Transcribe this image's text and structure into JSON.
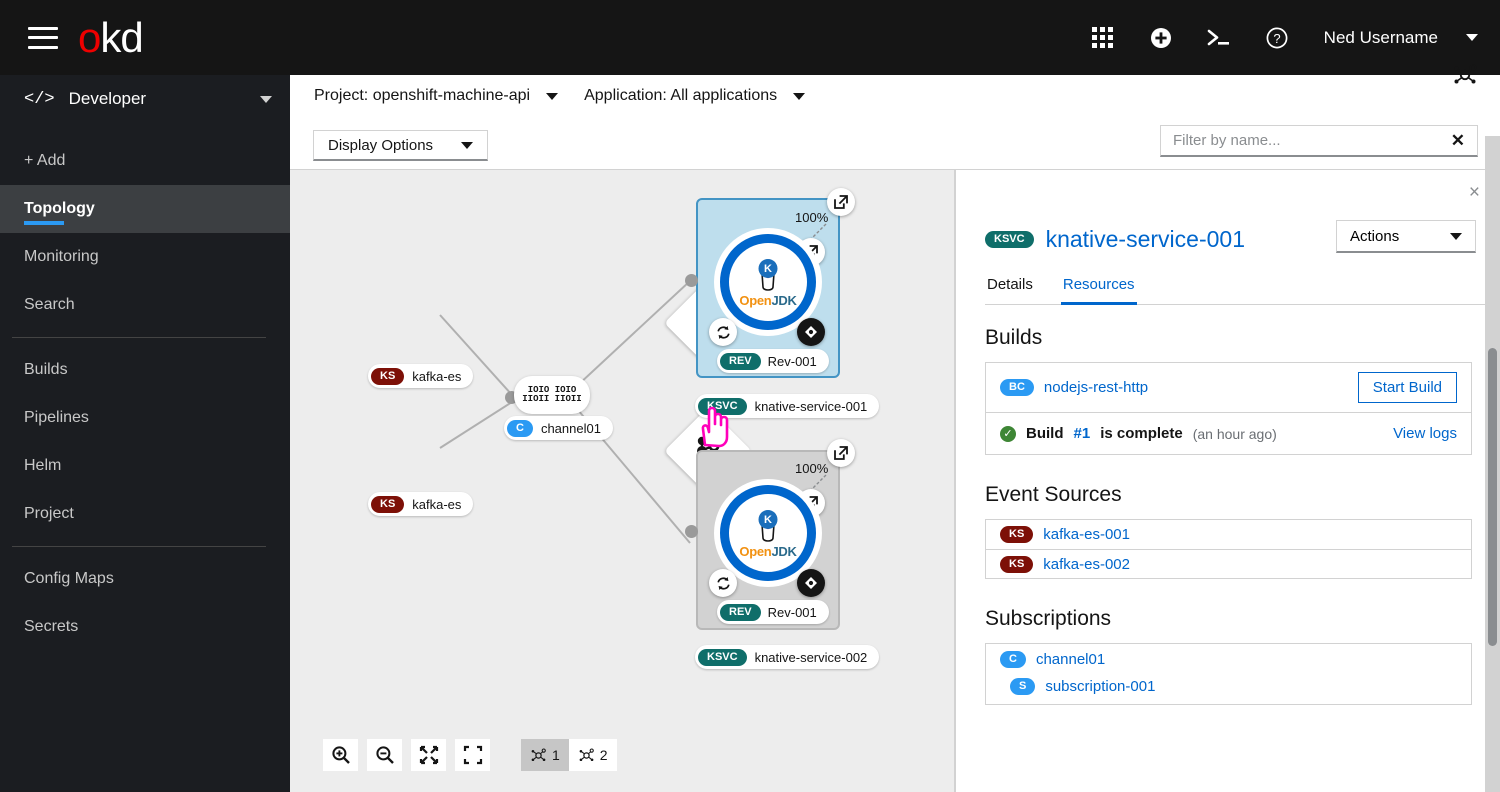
{
  "masthead": {
    "logo_o": "o",
    "logo_kd": "kd",
    "icons": [
      "grid-icon",
      "plus-circle-icon",
      "terminal-icon",
      "help-icon"
    ],
    "username": "Ned Username"
  },
  "sidebar": {
    "perspective": "Developer",
    "perspective_icon": "code-icon",
    "items": [
      {
        "label": "+ Add",
        "active": false
      },
      {
        "label": "Topology",
        "active": true
      },
      {
        "label": "Monitoring",
        "active": false
      },
      {
        "label": "Search",
        "active": false
      },
      {
        "label": "Builds",
        "active": false
      },
      {
        "label": "Pipelines",
        "active": false
      },
      {
        "label": "Helm",
        "active": false
      },
      {
        "label": "Project",
        "active": false
      },
      {
        "label": "Config Maps",
        "active": false
      },
      {
        "label": "Secrets",
        "active": false
      }
    ]
  },
  "toolbar": {
    "project_filter": "Project: openshift-machine-api",
    "application_filter": "Application: All applications",
    "display_options": "Display Options",
    "filter_placeholder": "Filter by name...",
    "filter_value": "",
    "filter_clear": "✕",
    "topology_view_icon": "topology-icon"
  },
  "graph": {
    "nodes": [
      {
        "type": "event-source",
        "badge": "KS",
        "label": "kafka-es"
      },
      {
        "type": "event-source",
        "badge": "KS",
        "label": "kafka-es"
      },
      {
        "type": "channel",
        "badge": "C",
        "label": "channel01",
        "icon_text_line1": "IOIO IOIO",
        "icon_text_line2": "IIOII IIOII"
      }
    ],
    "services": [
      {
        "badge": "KSVC",
        "label": "knative-service-001",
        "selected": true,
        "traffic": "100%",
        "revision_badge": "REV",
        "revision_label": "Rev-001",
        "runtime": "OpenJDK",
        "runtime_open": "Open",
        "runtime_jdk": "JDK",
        "knative_mark": "K"
      },
      {
        "badge": "KSVC",
        "label": "knative-service-002",
        "selected": false,
        "traffic": "100%",
        "revision_badge": "REV",
        "revision_label": "Rev-001",
        "runtime": "OpenJDK",
        "runtime_open": "Open",
        "runtime_jdk": "JDK",
        "knative_mark": "K"
      }
    ],
    "controls": [
      {
        "name": "zoom-in",
        "label": ""
      },
      {
        "name": "zoom-out",
        "label": ""
      },
      {
        "name": "fit-to-screen",
        "label": ""
      },
      {
        "name": "reset-view",
        "label": ""
      }
    ],
    "layout_toggles": [
      {
        "label": "1",
        "active": true
      },
      {
        "label": "2",
        "active": false
      }
    ]
  },
  "sidepanel": {
    "close": "×",
    "badge": "KSVC",
    "title": "knative-service-001",
    "actions": "Actions",
    "tabs": [
      {
        "label": "Details",
        "active": false
      },
      {
        "label": "Resources",
        "active": true
      }
    ],
    "builds": {
      "heading": "Builds",
      "config_badge": "BC",
      "config_name": "nodejs-rest-http",
      "start_build": "Start Build",
      "status_prefix": "Build",
      "status_number": "#1",
      "status_text": "is complete",
      "status_time": "(an hour ago)",
      "view_logs": "View logs"
    },
    "event_sources": {
      "heading": "Event Sources",
      "items": [
        {
          "badge": "KS",
          "name": "kafka-es-001"
        },
        {
          "badge": "KS",
          "name": "kafka-es-002"
        }
      ]
    },
    "subscriptions": {
      "heading": "Subscriptions",
      "channel_badge": "C",
      "channel_name": "channel01",
      "sub_badge": "S",
      "sub_name": "subscription-001"
    }
  },
  "colors": {
    "masthead_bg": "#151515",
    "sidebar_bg": "#1b1d21",
    "accent_blue": "#0066cc",
    "active_blue": "#2b9af3",
    "knative_teal": "#0f6e6a",
    "kafka_red": "#7d1007",
    "success_green": "#3e8635",
    "canvas_bg": "#ededed",
    "selected_group": "#bedeed",
    "cursor_pink": "#ff00bb"
  }
}
